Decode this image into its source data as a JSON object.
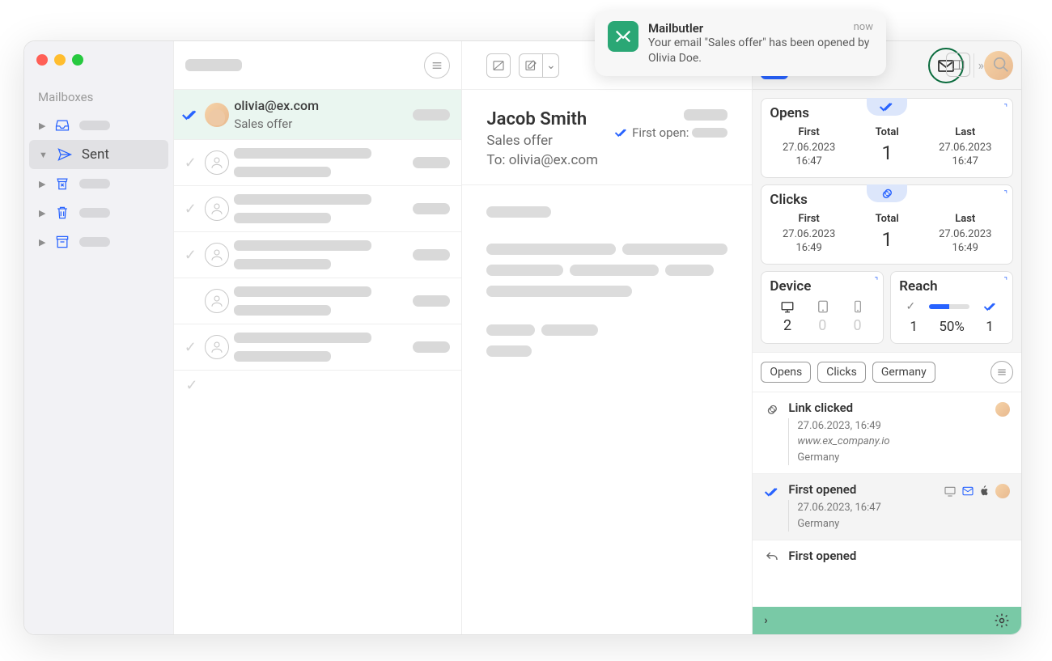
{
  "notification": {
    "app": "Mailbutler",
    "time": "now",
    "message": "Your email \"Sales offer\" has been opened by Olivia Doe."
  },
  "sidebar": {
    "heading": "Mailboxes",
    "selected_label": "Sent"
  },
  "message_list": {
    "selected": {
      "from": "olivia@ex.com",
      "subject": "Sales offer"
    }
  },
  "reader": {
    "from": "Jacob Smith",
    "subject": "Sales offer",
    "to_label": "To:",
    "to": "olivia@ex.com",
    "first_open_label": "First open:"
  },
  "panel": {
    "opens": {
      "title": "Opens",
      "cols": {
        "first": "First",
        "total": "Total",
        "last": "Last"
      },
      "first": {
        "date": "27.06.2023",
        "time": "16:47"
      },
      "total": "1",
      "last": {
        "date": "27.06.2023",
        "time": "16:47"
      }
    },
    "clicks": {
      "title": "Clicks",
      "cols": {
        "first": "First",
        "total": "Total",
        "last": "Last"
      },
      "first": {
        "date": "27.06.2023",
        "time": "16:49"
      },
      "total": "1",
      "last": {
        "date": "27.06.2023",
        "time": "16:49"
      }
    },
    "device": {
      "title": "Device",
      "desktop": "2",
      "tablet": "0",
      "mobile": "0"
    },
    "reach": {
      "title": "Reach",
      "sent": "1",
      "pct": "50%",
      "opened": "1"
    },
    "chips": [
      "Opens",
      "Clicks",
      "Germany"
    ],
    "events": [
      {
        "type": "link",
        "title": "Link clicked",
        "time": "27.06.2023, 16:49",
        "url": "www.ex_company.io",
        "loc": "Germany"
      },
      {
        "type": "open",
        "title": "First opened",
        "time": "27.06.2023, 16:47",
        "loc": "Germany"
      },
      {
        "type": "open2",
        "title": "First opened"
      }
    ]
  }
}
